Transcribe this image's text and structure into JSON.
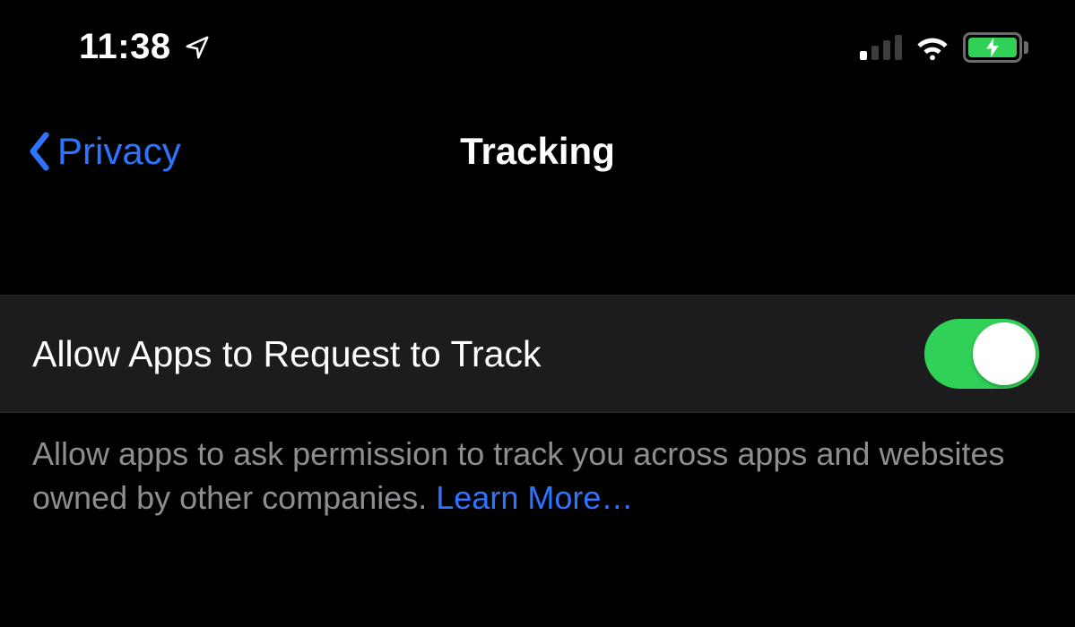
{
  "status_bar": {
    "time": "11:38",
    "cellular_level": 1,
    "battery_charging": true
  },
  "nav": {
    "back_label": "Privacy",
    "title": "Tracking"
  },
  "setting": {
    "label": "Allow Apps to Request to Track",
    "enabled": true
  },
  "footer": {
    "description": "Allow apps to ask permission to track you across apps and websites owned by other companies. ",
    "learn_more": "Learn More…"
  },
  "colors": {
    "accent": "#2f74ff",
    "toggle_on": "#31d158",
    "row_bg": "#1c1c1e"
  }
}
